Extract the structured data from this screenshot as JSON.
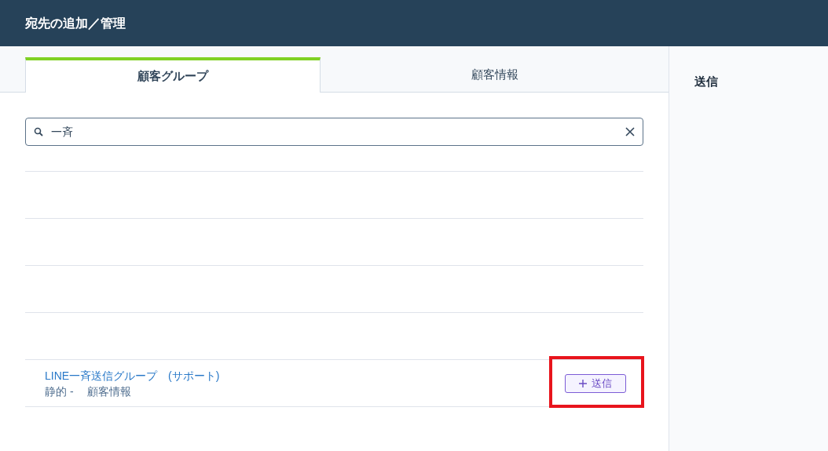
{
  "window": {
    "title": "宛先の追加／管理"
  },
  "tabs": [
    {
      "label": "顧客グループ",
      "selected": true
    },
    {
      "label": "顧客情報",
      "selected": false
    }
  ],
  "search": {
    "value": "一斉"
  },
  "results": [
    {
      "name": "LINE一斉送信グループ　(サポート)",
      "detail": "静的 - 　顧客情報",
      "button": "送信",
      "highlighted": true
    }
  ],
  "side_panel": {
    "title": "送信"
  }
}
